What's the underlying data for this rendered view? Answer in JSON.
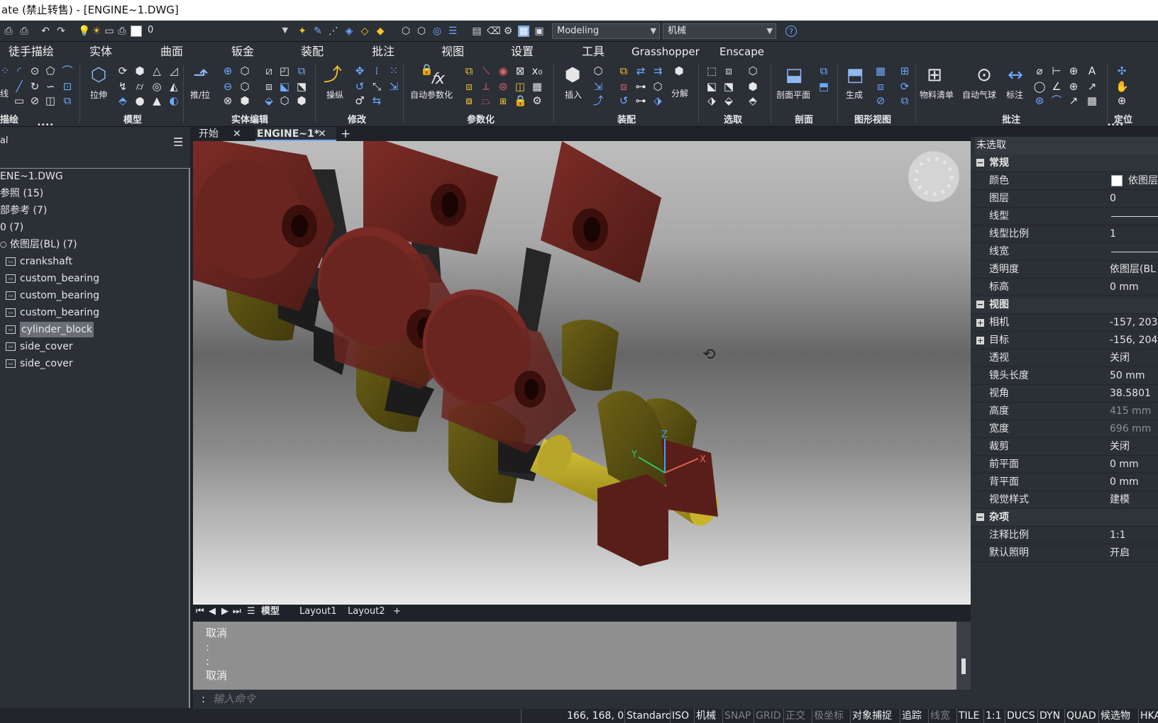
{
  "window": {
    "title": "ate (禁止转售) - [ENGINE~1.DWG]"
  },
  "quickaccess": {
    "layer_value": "0",
    "workspace": "Modeling",
    "profile": "机械"
  },
  "menu": [
    "徒手描绘",
    "实体",
    "曲面",
    "钣金",
    "装配",
    "批注",
    "视图",
    "设置",
    "工具",
    "Grasshopper",
    "Enscape"
  ],
  "ribbon": {
    "labels": {
      "extrude": "拉伸",
      "pushpull": "推/拉",
      "manipulate": "操纵",
      "autoparam": "自动参数化",
      "insert": "插入",
      "explode": "分解",
      "sectionplane": "剖面平面",
      "generate": "生成",
      "bom": "物料清单",
      "autoballoon": "自动气球",
      "dimension": "标注",
      "line": "线"
    },
    "groups": [
      "描绘",
      "模型",
      "实体编辑",
      "修改",
      "参数化",
      "装配",
      "选取",
      "剖面",
      "图形视图",
      "批注",
      "定位"
    ]
  },
  "left_panel": {
    "header": "al",
    "tree": [
      {
        "text": "ENE~1.DWG",
        "indent": 0,
        "icon": false,
        "selected": false
      },
      {
        "text": "参照 (15)",
        "indent": 0,
        "icon": false,
        "selected": false
      },
      {
        "text": "部参考 (7)",
        "indent": 0,
        "icon": false,
        "selected": false
      },
      {
        "text": "0 (7)",
        "indent": 0,
        "icon": false,
        "selected": false
      },
      {
        "text": "依图层(BL) (7)",
        "indent": 1,
        "icon": false,
        "selected": false
      },
      {
        "text": "crankshaft",
        "indent": 2,
        "icon": true,
        "selected": false
      },
      {
        "text": "custom_bearing",
        "indent": 2,
        "icon": true,
        "selected": false
      },
      {
        "text": "custom_bearing",
        "indent": 2,
        "icon": true,
        "selected": false
      },
      {
        "text": "custom_bearing",
        "indent": 2,
        "icon": true,
        "selected": false
      },
      {
        "text": "cylinder_block",
        "indent": 2,
        "icon": true,
        "selected": true
      },
      {
        "text": "side_cover",
        "indent": 2,
        "icon": true,
        "selected": false
      },
      {
        "text": "side_cover",
        "indent": 2,
        "icon": true,
        "selected": false
      }
    ]
  },
  "doc_tabs": {
    "start": "开始",
    "engine": "ENGINE~1*",
    "add": "+"
  },
  "viewport": {
    "ucs": {
      "x": "X",
      "y": "Y",
      "z": "Z"
    }
  },
  "layout_tabs": {
    "model": "模型",
    "layout1": "Layout1",
    "layout2": "Layout2",
    "add": "+"
  },
  "command": {
    "history": [
      "取消",
      ":",
      ":",
      "取消"
    ],
    "prompt": ":",
    "placeholder": "输入命令"
  },
  "properties": {
    "selection": "未选取",
    "sections": [
      {
        "title": "常规",
        "rows": [
          {
            "name": "颜色",
            "value": "依图层",
            "swatch": true
          },
          {
            "name": "图层",
            "value": "0"
          },
          {
            "name": "线型",
            "value": "",
            "line": true
          },
          {
            "name": "线型比例",
            "value": "1"
          },
          {
            "name": "线宽",
            "value": "",
            "line": true
          },
          {
            "name": "透明度",
            "value": "依图层(BL"
          },
          {
            "name": "标高",
            "value": "0 mm"
          }
        ]
      },
      {
        "title": "视图",
        "rows": [
          {
            "name": "相机",
            "value": "-157, 203,",
            "plus": true
          },
          {
            "name": "目标",
            "value": "-156, 204,",
            "plus": true
          },
          {
            "name": "透视",
            "value": "关闭"
          },
          {
            "name": "镜头长度",
            "value": "50 mm"
          },
          {
            "name": "视角",
            "value": "38.5801"
          },
          {
            "name": "高度",
            "value": "415 mm",
            "dim": true
          },
          {
            "name": "宽度",
            "value": "696 mm",
            "dim": true
          },
          {
            "name": "裁剪",
            "value": "关闭"
          },
          {
            "name": "前平面",
            "value": "0 mm"
          },
          {
            "name": "背平面",
            "value": "0 mm"
          },
          {
            "name": "视觉样式",
            "value": "建模"
          }
        ]
      },
      {
        "title": "杂项",
        "rows": [
          {
            "name": "注释比例",
            "value": "1:1"
          },
          {
            "name": "默认照明",
            "value": "开启"
          }
        ]
      }
    ]
  },
  "status": {
    "coords": "166, 168, 0",
    "items": [
      {
        "t": "Standard",
        "on": true
      },
      {
        "t": "ISO",
        "on": true
      },
      {
        "t": "机械",
        "on": true
      },
      {
        "t": "SNAP",
        "on": false
      },
      {
        "t": "GRID",
        "on": false
      },
      {
        "t": "正交",
        "on": false
      },
      {
        "t": "极坐标",
        "on": false
      },
      {
        "t": "对象捕捉",
        "on": true
      },
      {
        "t": "追踪",
        "on": true
      },
      {
        "t": "线宽",
        "on": false
      },
      {
        "t": "TILE",
        "on": true
      },
      {
        "t": "1:1",
        "on": true
      },
      {
        "t": "DUCS",
        "on": true
      },
      {
        "t": "DYN",
        "on": true
      },
      {
        "t": "QUAD",
        "on": true
      },
      {
        "t": "候选物",
        "on": true
      },
      {
        "t": "HKA",
        "on": true
      }
    ]
  },
  "colors": {
    "piston": "#6b2520",
    "crank": "#5e5312",
    "shaft": "#c8b42a",
    "rod": "#2a2a2a"
  }
}
